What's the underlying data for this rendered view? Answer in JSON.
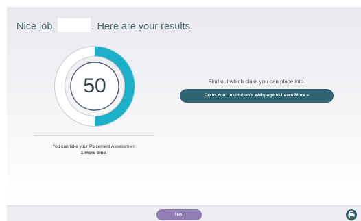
{
  "results": {
    "greeting": "Nice job,",
    "suffix": ". Here are your results.",
    "score": "50",
    "score_fraction": 0.5,
    "attempts_line1": "You can take your Placement Assessment",
    "attempts_count": "1 more time",
    "attempts_end": "."
  },
  "placement": {
    "prompt": "Find out which class you can place into.",
    "button_label": "Go to Your Institution's Webpage to Learn More »"
  },
  "footer": {
    "next_label": "Next",
    "print_icon": "printer-icon"
  },
  "colors": {
    "score_fill": "#1cb0c8",
    "button": "#2f6472",
    "next_button": "#8f7db4"
  }
}
